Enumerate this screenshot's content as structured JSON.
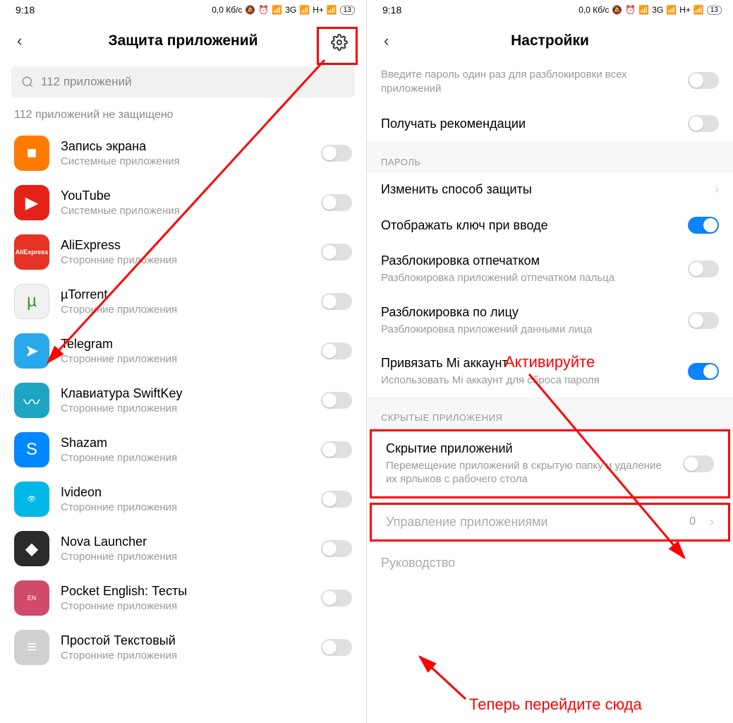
{
  "left": {
    "status": {
      "time": "9:18",
      "speed": "0,0 Кб/с",
      "net1": "3G",
      "net2": "H+",
      "battery": "13"
    },
    "title": "Защита приложений",
    "search": "112 приложений",
    "section_label": "112 приложений не защищено",
    "sub_system": "Системные приложения",
    "sub_third": "Сторонние приложения",
    "apps": [
      {
        "name": "Запись экрана",
        "sub": "system",
        "icon": "ic-rec"
      },
      {
        "name": "YouTube",
        "sub": "system",
        "icon": "ic-yt"
      },
      {
        "name": "AliExpress",
        "sub": "third",
        "icon": "ic-ali"
      },
      {
        "name": "µTorrent",
        "sub": "third",
        "icon": "ic-ut"
      },
      {
        "name": "Telegram",
        "sub": "third",
        "icon": "ic-tg"
      },
      {
        "name": "Клавиатура SwiftKey",
        "sub": "third",
        "icon": "ic-sw"
      },
      {
        "name": "Shazam",
        "sub": "third",
        "icon": "ic-sh"
      },
      {
        "name": "Ivideon",
        "sub": "third",
        "icon": "ic-iv"
      },
      {
        "name": "Nova Launcher",
        "sub": "third",
        "icon": "ic-nova"
      },
      {
        "name": "Pocket English: Тесты",
        "sub": "third",
        "icon": "ic-pe"
      },
      {
        "name": "Простой Текстовый",
        "sub": "third",
        "icon": "ic-txt"
      }
    ]
  },
  "right": {
    "status": {
      "time": "9:18",
      "speed": "0,0 Кб/с",
      "net1": "3G",
      "net2": "H+",
      "battery": "13"
    },
    "title": "Настройки",
    "group_sub": "Введите пароль один раз для разблокировки всех приложений",
    "recommend": "Получать рекомендации",
    "section_password": "ПАРОЛЬ",
    "change_method": "Изменить способ защиты",
    "show_key": "Отображать ключ при вводе",
    "fp_title": "Разблокировка отпечатком",
    "fp_sub": "Разблокировка приложений отпечатком пальца",
    "face_title": "Разблокировка по лицу",
    "face_sub": "Разблокировка приложений данными лица",
    "mi_title": "Привязать Mi аккаунт",
    "mi_sub": "Использовать Mi аккаунт для сброса пароля",
    "section_hidden": "СКРЫТЫЕ ПРИЛОЖЕНИЯ",
    "hide_title": "Скрытие приложений",
    "hide_sub": "Перемещение приложений в скрытую папку и удаление их ярлыков с рабочего стола",
    "manage_title": "Управление приложениями",
    "manage_value": "0",
    "guide": "Руководство"
  },
  "annotations": {
    "activate": "Активируйте",
    "goto": "Теперь перейдите сюда"
  }
}
